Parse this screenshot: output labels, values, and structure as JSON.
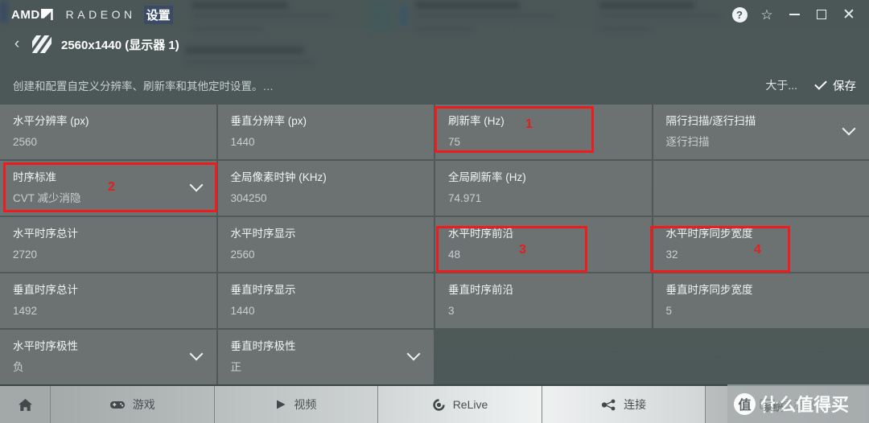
{
  "titlebar": {
    "brand_amd": "AMD",
    "brand_radeon": "RADEON",
    "brand_settings": "设置",
    "help_glyph": "?",
    "star_glyph": "☆",
    "close_glyph": "✕"
  },
  "breadcrumb": {
    "back_glyph": "‹",
    "title": "2560x1440 (显示器 1)"
  },
  "subrow": {
    "subtitle": "创建和配置自定义分辨率、刷新率和其他定时设置。…",
    "greater_than": "大于...",
    "save_label": "保存"
  },
  "grid": {
    "rows": [
      {
        "cells": [
          {
            "label": "水平分辨率 (px)",
            "value": "2560",
            "chevron": false,
            "kind": "field"
          },
          {
            "label": "垂直分辨率 (px)",
            "value": "1440",
            "chevron": false,
            "kind": "field"
          },
          {
            "label": "刷新率 (Hz)",
            "value": "75",
            "chevron": false,
            "kind": "field"
          },
          {
            "label": "隔行扫描/逐行扫描",
            "value": "逐行扫描",
            "chevron": true,
            "kind": "dropdown"
          }
        ]
      },
      {
        "cells": [
          {
            "label": "时序标准",
            "value": "CVT 减少消隐",
            "chevron": true,
            "kind": "dropdown"
          },
          {
            "label": "全局像素时钟 (KHz)",
            "value": "304250",
            "chevron": false,
            "kind": "field"
          },
          {
            "label": "全局刷新率 (Hz)",
            "value": "74.971",
            "chevron": false,
            "kind": "field"
          },
          {
            "label": "",
            "value": "",
            "chevron": false,
            "kind": "empty"
          }
        ]
      },
      {
        "cells": [
          {
            "label": "水平时序总计",
            "value": "2720",
            "chevron": false,
            "kind": "field"
          },
          {
            "label": "水平时序显示",
            "value": "2560",
            "chevron": false,
            "kind": "field"
          },
          {
            "label": "水平时序前沿",
            "value": "48",
            "chevron": false,
            "kind": "field"
          },
          {
            "label": "水平时序同步宽度",
            "value": "32",
            "chevron": false,
            "kind": "field"
          }
        ]
      },
      {
        "cells": [
          {
            "label": "垂直时序总计",
            "value": "1492",
            "chevron": false,
            "kind": "field"
          },
          {
            "label": "垂直时序显示",
            "value": "1440",
            "chevron": false,
            "kind": "field"
          },
          {
            "label": "垂直时序前沿",
            "value": "3",
            "chevron": false,
            "kind": "field"
          },
          {
            "label": "垂直时序同步宽度",
            "value": "5",
            "chevron": false,
            "kind": "field"
          }
        ]
      },
      {
        "cells": [
          {
            "label": "水平时序极性",
            "value": "负",
            "chevron": true,
            "kind": "dropdown"
          },
          {
            "label": "垂直时序极性",
            "value": "正",
            "chevron": true,
            "kind": "dropdown"
          },
          {
            "label": "",
            "value": "",
            "chevron": false,
            "kind": "blank"
          },
          {
            "label": "",
            "value": "",
            "chevron": false,
            "kind": "blank"
          }
        ]
      }
    ]
  },
  "annotations": [
    {
      "number": "1",
      "target": "刷新率 (Hz)",
      "color": "#ee1c1c"
    },
    {
      "number": "2",
      "target": "时序标准",
      "color": "#ee1c1c"
    },
    {
      "number": "3",
      "target": "水平时序前沿",
      "color": "#ee1c1c"
    },
    {
      "number": "4",
      "target": "水平时序同步宽度",
      "color": "#ee1c1c"
    }
  ],
  "bottom_nav": {
    "items": [
      {
        "label": "",
        "icon": "home-icon"
      },
      {
        "label": "游戏",
        "icon": "gamepad-icon"
      },
      {
        "label": "视频",
        "icon": "play-icon"
      },
      {
        "label": "ReLive",
        "icon": "relive-icon"
      },
      {
        "label": "连接",
        "icon": "share-nodes-icon"
      },
      {
        "label": "显示器",
        "icon": "monitor-icon"
      }
    ]
  },
  "watermark": {
    "badge": "值",
    "text": "什么值得买",
    "ghost": "系统"
  }
}
